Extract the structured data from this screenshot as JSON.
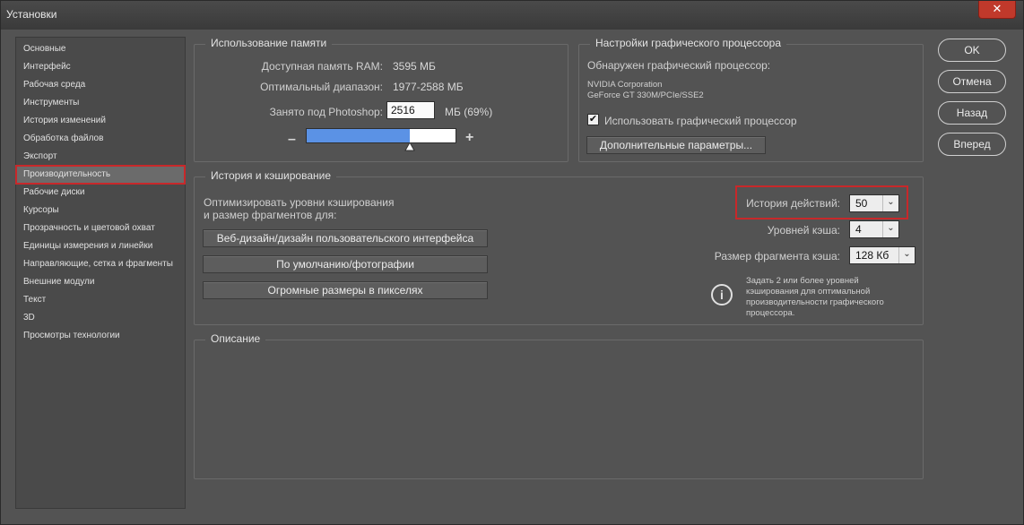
{
  "window": {
    "title": "Установки",
    "close_glyph": "✕"
  },
  "sidebar": {
    "items": [
      "Основные",
      "Интерфейс",
      "Рабочая среда",
      "Инструменты",
      "История изменений",
      "Обработка файлов",
      "Экспорт",
      "Производительность",
      "Рабочие диски",
      "Курсоры",
      "Прозрачность и цветовой охват",
      "Единицы измерения и линейки",
      "Направляющие, сетка и фрагменты",
      "Внешние модули",
      "Текст",
      "3D",
      "Просмотры технологии"
    ],
    "selected_index": 7
  },
  "memory": {
    "title": "Использование памяти",
    "available_label": "Доступная память RAM:",
    "available_value": "3595 МБ",
    "optimal_label": "Оптимальный диапазон:",
    "optimal_value": "1977-2588 МБ",
    "used_label": "Занято под Photoshop:",
    "used_value": "2516",
    "used_suffix": "МБ (69%)",
    "minus": "–",
    "plus": "+",
    "slider_fraction": 0.69
  },
  "gpu": {
    "title": "Настройки графического процессора",
    "detected_label": "Обнаружен графический процессор:",
    "vendor": "NVIDIA Corporation",
    "model": "GeForce GT 330M/PCIe/SSE2",
    "use_gpu_label": "Использовать графический процессор",
    "use_gpu_checked": true,
    "check_glyph": "✔",
    "advanced_button": "Дополнительные параметры..."
  },
  "history": {
    "title": "История и кэширование",
    "optimize_line1": "Оптимизировать уровни кэширования",
    "optimize_line2": "и размер фрагментов для:",
    "buttons": [
      "Веб-дизайн/дизайн пользовательского интерфейса",
      "По умолчанию/фотографии",
      "Огромные размеры в пикселях"
    ],
    "history_states_label": "История действий:",
    "history_states_value": "50",
    "cache_levels_label": "Уровней кэша:",
    "cache_levels_value": "4",
    "tile_size_label": "Размер фрагмента кэша:",
    "tile_size_value": "128 Кб",
    "chevron": "⌄",
    "info_glyph": "i",
    "info_text": [
      "Задать 2 или более уровней",
      "кэширования для оптимальной",
      "производительности графического",
      "процессора."
    ]
  },
  "description": {
    "title": "Описание"
  },
  "dialog_buttons": {
    "ok": "OK",
    "cancel": "Отмена",
    "prev": "Назад",
    "next": "Вперед"
  }
}
